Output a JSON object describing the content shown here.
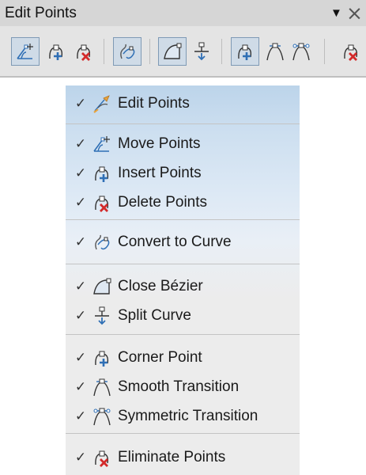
{
  "toolbar": {
    "title": "Edit Points",
    "menu_arrow": "▼",
    "close": "×"
  },
  "menu": {
    "groups": [
      {
        "items": [
          {
            "label": "Edit Points",
            "icon": "edit-points-icon",
            "checked": "✓"
          }
        ]
      },
      {
        "items": [
          {
            "label": "Move Points",
            "icon": "move-points-icon",
            "checked": "✓"
          },
          {
            "label": "Insert Points",
            "icon": "insert-points-icon",
            "checked": "✓"
          },
          {
            "label": "Delete Points",
            "icon": "delete-points-icon",
            "checked": "✓"
          }
        ]
      },
      {
        "items": [
          {
            "label": "Convert to Curve",
            "icon": "convert-to-curve-icon",
            "checked": "✓"
          }
        ]
      },
      {
        "items": [
          {
            "label": "Close Bézier",
            "icon": "close-bezier-icon",
            "checked": "✓"
          },
          {
            "label": "Split Curve",
            "icon": "split-curve-icon",
            "checked": "✓"
          }
        ]
      },
      {
        "items": [
          {
            "label": "Corner Point",
            "icon": "corner-point-icon",
            "checked": "✓"
          },
          {
            "label": "Smooth Transition",
            "icon": "smooth-transition-icon",
            "checked": "✓"
          },
          {
            "label": "Symmetric Transition",
            "icon": "symmetric-transition-icon",
            "checked": "✓"
          }
        ]
      },
      {
        "items": [
          {
            "label": "Eliminate Points",
            "icon": "eliminate-points-icon",
            "checked": "✓"
          }
        ]
      }
    ]
  },
  "colors": {
    "accent_blue": "#2f6fb5",
    "delete_red": "#d32a2a",
    "orange": "#e8a33d"
  }
}
